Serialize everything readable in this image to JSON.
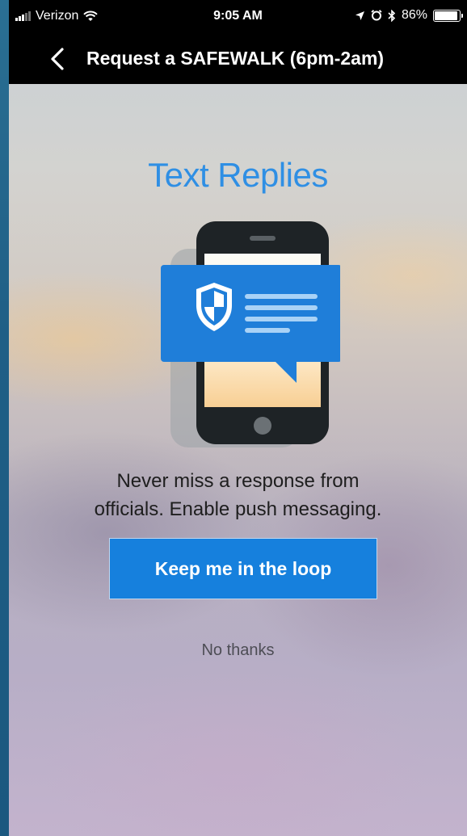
{
  "status_bar": {
    "carrier": "Verizon",
    "time": "9:05 AM",
    "battery_percent": "86%",
    "battery_level": 0.86,
    "icons": [
      "signal-icon",
      "wifi-icon",
      "location-icon",
      "alarm-icon",
      "bluetooth-icon",
      "battery-icon"
    ]
  },
  "nav": {
    "back_icon": "chevron-left-icon",
    "title": "Request a SAFEWALK (6pm-2am)"
  },
  "content": {
    "headline": "Text Replies",
    "illustration": "phone-with-message-bubble",
    "body_line1": "Never miss a response from",
    "body_line2": "officials. Enable push messaging.",
    "primary_button": "Keep me in the loop",
    "secondary_link": "No thanks"
  },
  "colors": {
    "accent": "#2f8fe4",
    "button": "#1680dd",
    "bar": "#000000"
  }
}
